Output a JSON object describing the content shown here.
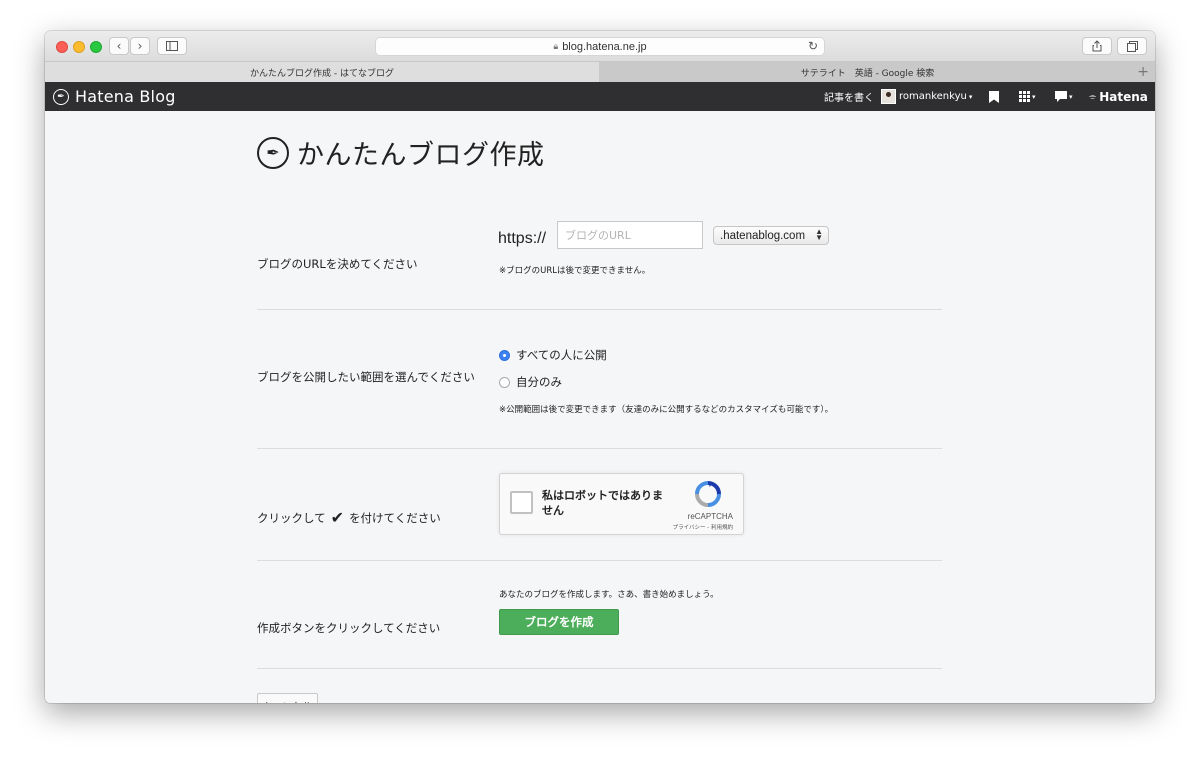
{
  "browser": {
    "url": "blog.hatena.ne.jp",
    "tabs": [
      {
        "label": "かんたんブログ作成 - はてなブログ",
        "active": true
      },
      {
        "label": "サテライト　英語 - Google 検索",
        "active": false
      }
    ],
    "new_tab_label": "+"
  },
  "header": {
    "logo": "Hatena Blog",
    "write_link": "記事を書く",
    "username": "romankenkyu",
    "brand": "Hatena"
  },
  "page": {
    "title": "かんたんブログ作成",
    "url_section": {
      "label": "ブログのURLを決めてください",
      "prefix": "https://",
      "placeholder": "ブログのURL",
      "domain_selected": ".hatenablog.com",
      "note": "※ブログのURLは後で変更できません。"
    },
    "visibility_section": {
      "label": "ブログを公開したい範囲を選んでください",
      "options": [
        {
          "label": "すべての人に公開",
          "selected": true
        },
        {
          "label": "自分のみ",
          "selected": false
        }
      ],
      "note": "※公開範囲は後で変更できます（友達のみに公開するなどのカスタマイズも可能です）。"
    },
    "captcha_section": {
      "label_before": "クリックして",
      "label_check": "✔",
      "label_after": "を付けてください",
      "checkbox_text": "私はロボットではありません",
      "brand": "reCAPTCHA",
      "terms": "プライバシー - 利用規約"
    },
    "create_section": {
      "label": "作成ボタンをクリックしてください",
      "note": "あなたのブログを作成します。さあ、書き始めましょう。",
      "button": "ブログを作成"
    },
    "cancel_button": "キャンセル"
  },
  "colors": {
    "header_bg": "#2f2f31",
    "create_button": "#4cae5b",
    "radio_selected": "#3b82f6"
  }
}
